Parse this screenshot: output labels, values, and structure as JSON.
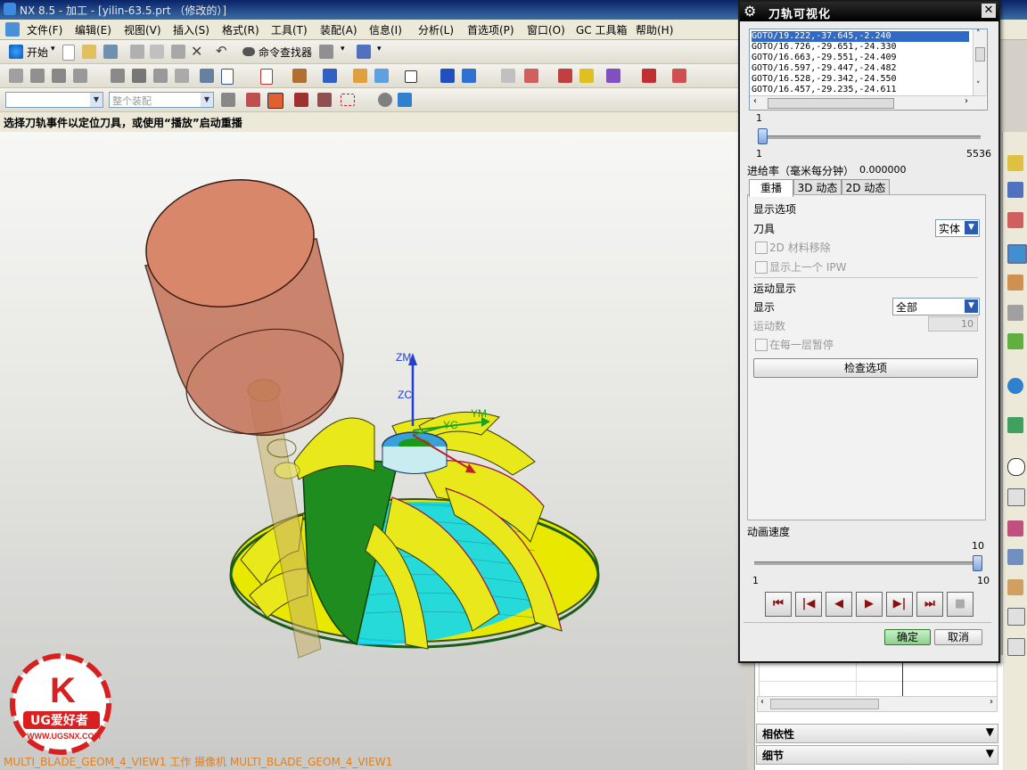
{
  "app": {
    "title": "NX 8.5 - 加工 - [yilin-63.5.prt （修改的）]"
  },
  "menus": [
    "文件(F)",
    "编辑(E)",
    "视图(V)",
    "插入(S)",
    "格式(R)",
    "工具(T)",
    "装配(A)",
    "信息(I)",
    "分析(L)",
    "首选项(P)",
    "窗口(O)",
    "GC 工具箱",
    "帮助(H)"
  ],
  "toolbar": {
    "start_label": "开始",
    "command_finder_label": "命令查找器",
    "assembly_filter_placeholder": "整个装配"
  },
  "cue_line": "选择刀轨事件以定位刀具，或使用“播放”启动重播",
  "status_line": "MULTI_BLADE_GEOM_4_VIEW1 工作 摄像机 MULTI_BLADE_GEOM_4_VIEW1",
  "viewport": {
    "axis_labels": [
      "ZM",
      "ZC",
      "YM",
      "YC"
    ],
    "logo_text": "UG爱好者",
    "logo_url": "WWW.UGSNX.COM"
  },
  "dialog": {
    "title": "刀轨可视化",
    "path_events": [
      "GOTO/19.222,-37.645,-2.240",
      "GOTO/16.726,-29.651,-24.330",
      "GOTO/16.663,-29.551,-24.409",
      "GOTO/16.597,-29.447,-24.482",
      "GOTO/16.528,-29.342,-24.550",
      "GOTO/16.457,-29.235,-24.611"
    ],
    "selected_event_index": 0,
    "event_slider": {
      "current": "1",
      "min": "1",
      "max": "5536",
      "fraction": 0.0
    },
    "feed_rate_label": "进给率（毫米每分钟）",
    "feed_rate_value": "0.000000",
    "tabs": [
      "重播",
      "3D 动态",
      "2D 动态"
    ],
    "active_tab": 0,
    "display_options_label": "显示选项",
    "tool_label": "刀具",
    "tool_value": "实体",
    "material_removal_2d": "2D 材料移除",
    "show_previous_ipw": "显示上一个 IPW",
    "motion_display_label": "运动显示",
    "display_label": "显示",
    "display_value": "全部",
    "motion_count_label": "运动数",
    "motion_count_value": "10",
    "pause_each_layer": "在每一层暂停",
    "check_options_button": "检查选项",
    "animation_speed_label": "动画速度",
    "speed": {
      "current": "10",
      "min": "1",
      "max": "10",
      "fraction": 1.0
    },
    "ok_button": "确定",
    "cancel_button": "取消"
  },
  "nav_panel": {
    "dependencies_label": "相依性",
    "details_label": "细节"
  },
  "colors": {
    "tool_holder": "#d98060",
    "blade_yellow": "#ffff00",
    "blade_green": "#1a8c1a",
    "toolpath_cyan": "#00e5ff"
  }
}
